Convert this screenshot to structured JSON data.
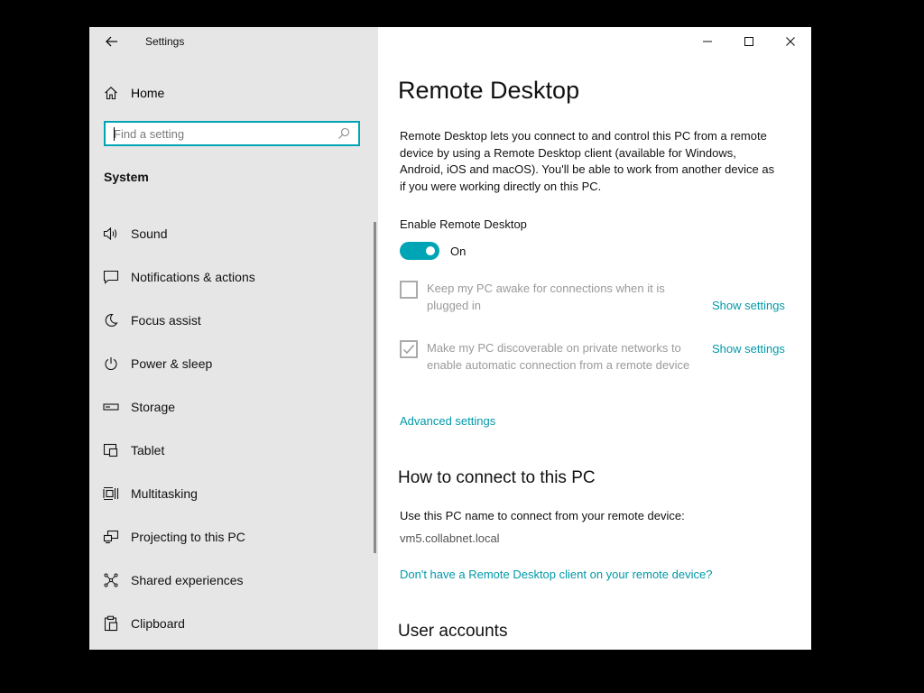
{
  "window": {
    "app_title": "Settings",
    "controls": {
      "minimize": "minimize",
      "maximize": "maximize",
      "close": "close"
    }
  },
  "sidebar": {
    "home_label": "Home",
    "search": {
      "placeholder": "Find a setting",
      "value": ""
    },
    "section_title": "System",
    "items": [
      {
        "label": "Sound",
        "icon": "speaker-icon"
      },
      {
        "label": "Notifications & actions",
        "icon": "notification-icon"
      },
      {
        "label": "Focus assist",
        "icon": "moon-icon"
      },
      {
        "label": "Power & sleep",
        "icon": "power-icon"
      },
      {
        "label": "Storage",
        "icon": "storage-icon"
      },
      {
        "label": "Tablet",
        "icon": "tablet-icon"
      },
      {
        "label": "Multitasking",
        "icon": "multitasking-icon"
      },
      {
        "label": "Projecting to this PC",
        "icon": "projecting-icon"
      },
      {
        "label": "Shared experiences",
        "icon": "shared-experiences-icon"
      },
      {
        "label": "Clipboard",
        "icon": "clipboard-icon"
      }
    ]
  },
  "main": {
    "title": "Remote Desktop",
    "description": "Remote Desktop lets you connect to and control this PC from a remote device by using a Remote Desktop client (available for Windows, Android, iOS and macOS). You'll be able to work from another device as if you were working directly on this PC.",
    "enable": {
      "label": "Enable Remote Desktop",
      "state": "On",
      "checked": true
    },
    "options": [
      {
        "text": "Keep my PC awake for connections when it is plugged in",
        "checked": false,
        "link": "Show settings"
      },
      {
        "text": "Make my PC discoverable on private networks to enable automatic connection from a remote device",
        "checked": true,
        "link": "Show settings"
      }
    ],
    "advanced_link": "Advanced settings",
    "connect": {
      "heading": "How to connect to this PC",
      "instruction": "Use this PC name to connect from your remote device:",
      "pc_name": "vm5.collabnet.local",
      "client_link": "Don't have a Remote Desktop client on your remote device?"
    },
    "user_accounts_heading": "User accounts"
  },
  "colors": {
    "accent": "#00a5b5",
    "link": "#0099a8",
    "sidebar_bg": "#e6e6e6",
    "disabled_text": "#9a9a9a"
  }
}
